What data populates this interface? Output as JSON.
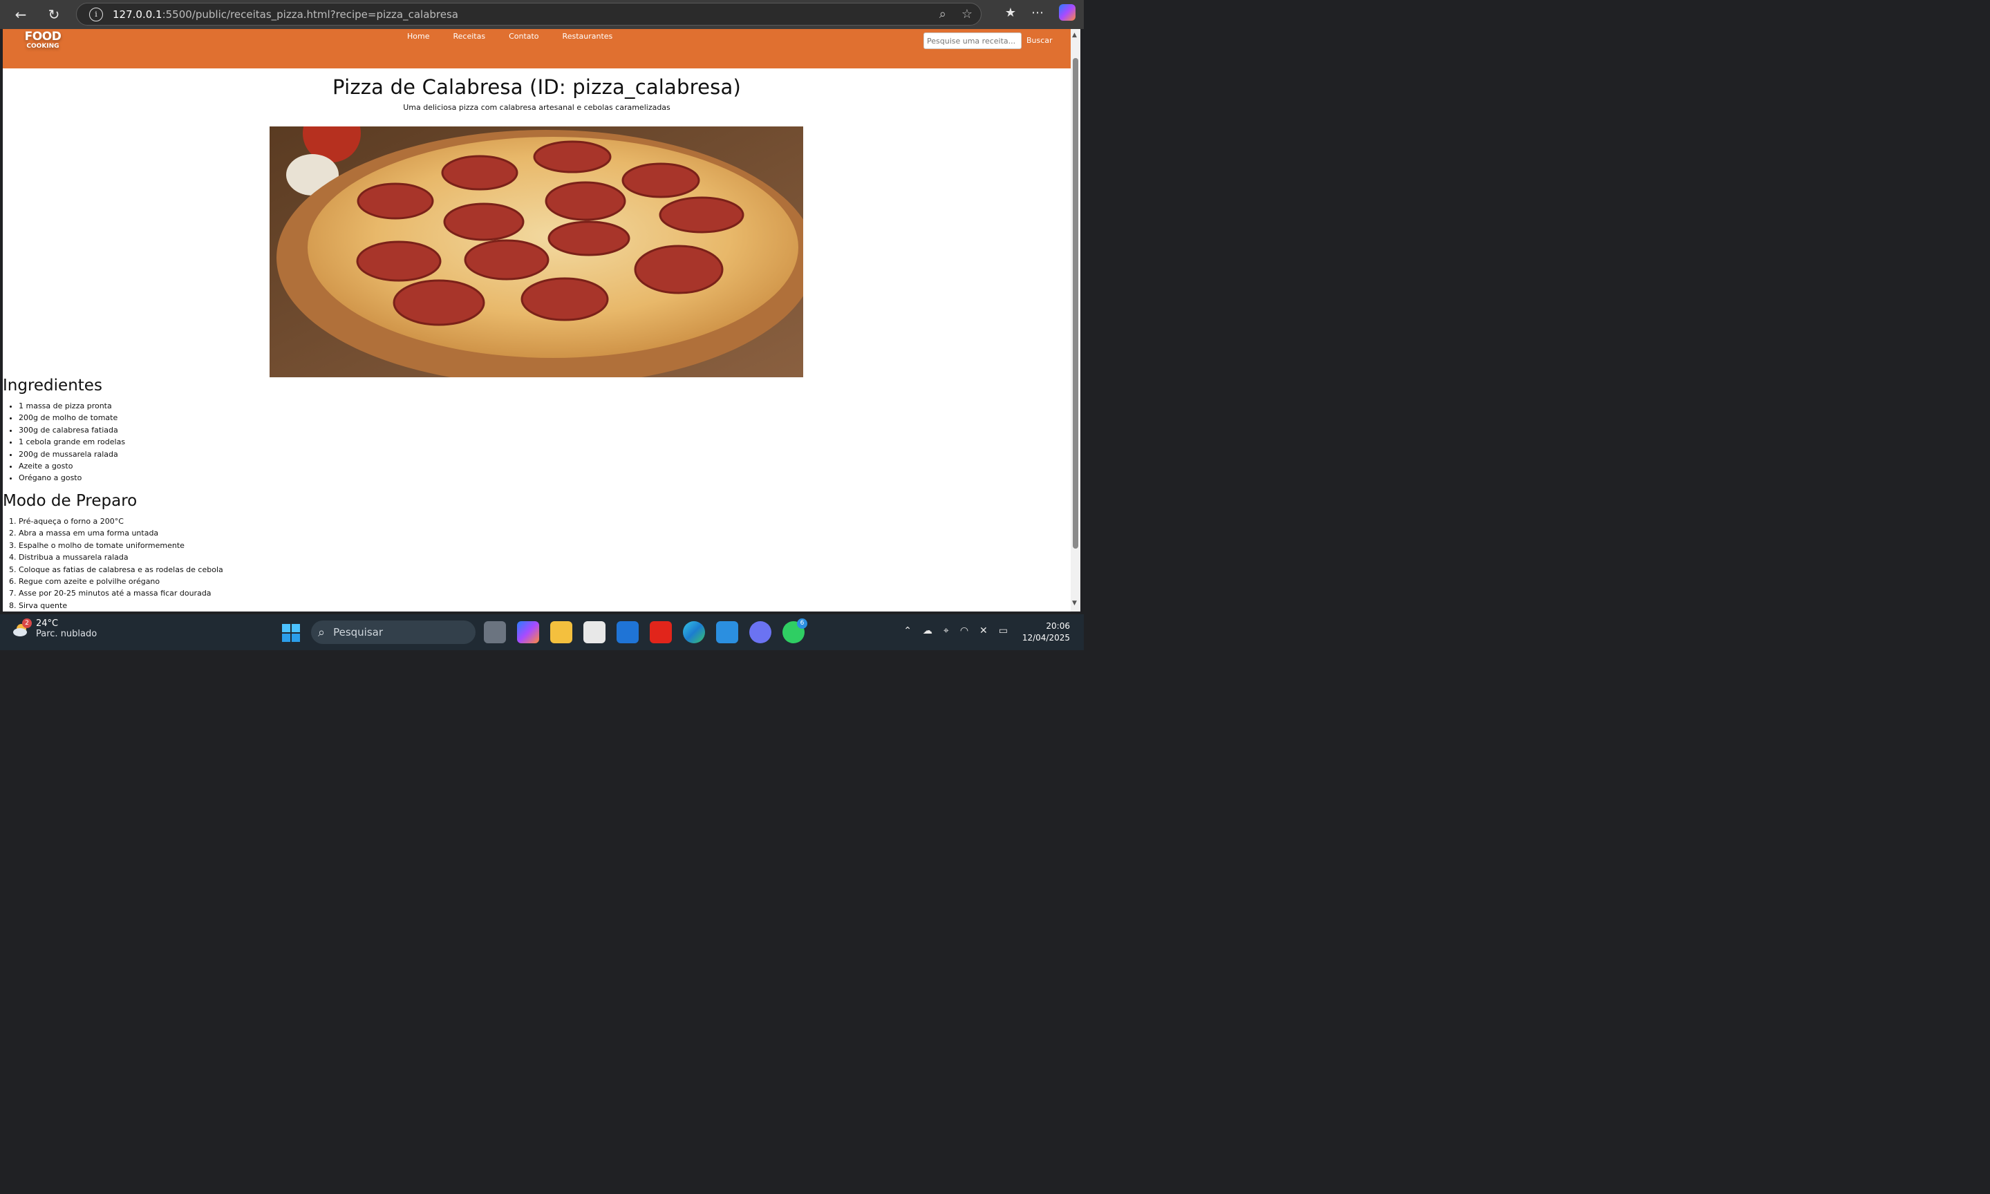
{
  "browser": {
    "url_host": "127.0.0.1",
    "url_rest": ":5500/public/receitas_pizza.html?recipe=pizza_calabresa"
  },
  "site": {
    "logo_line1": "FOOD",
    "logo_line2": "COOKING",
    "menu": [
      "Home",
      "Receitas",
      "Contato",
      "Restaurantes"
    ],
    "search_placeholder": "Pesquise uma receita...",
    "search_button": "Buscar"
  },
  "recipe": {
    "title": "Pizza de Calabresa (ID: pizza_calabresa)",
    "subtitle": "Uma deliciosa pizza com calabresa artesanal e cebolas caramelizadas",
    "ingredients_title": "Ingredientes",
    "ingredients": [
      "1 massa de pizza pronta",
      "200g de molho de tomate",
      "300g de calabresa fatiada",
      "1 cebola grande em rodelas",
      "200g de mussarela ralada",
      "Azeite a gosto",
      "Orégano a gosto"
    ],
    "steps_title": "Modo de Preparo",
    "steps": [
      "Pré-aqueça o forno a 200°C",
      "Abra a massa em uma forma untada",
      "Espalhe o molho de tomate uniformemente",
      "Distribua a mussarela ralada",
      "Coloque as fatias de calabresa e as rodelas de cebola",
      "Regue com azeite e polvilhe orégano",
      "Asse por 20-25 minutos até a massa ficar dourada",
      "Sirva quente"
    ]
  },
  "taskbar": {
    "weather_badge": "2",
    "temperature": "24°C",
    "condition": "Parc. nublado",
    "search_label": "Pesquisar",
    "whatsapp_badge": "6",
    "time": "20:06",
    "date": "12/04/2025"
  }
}
